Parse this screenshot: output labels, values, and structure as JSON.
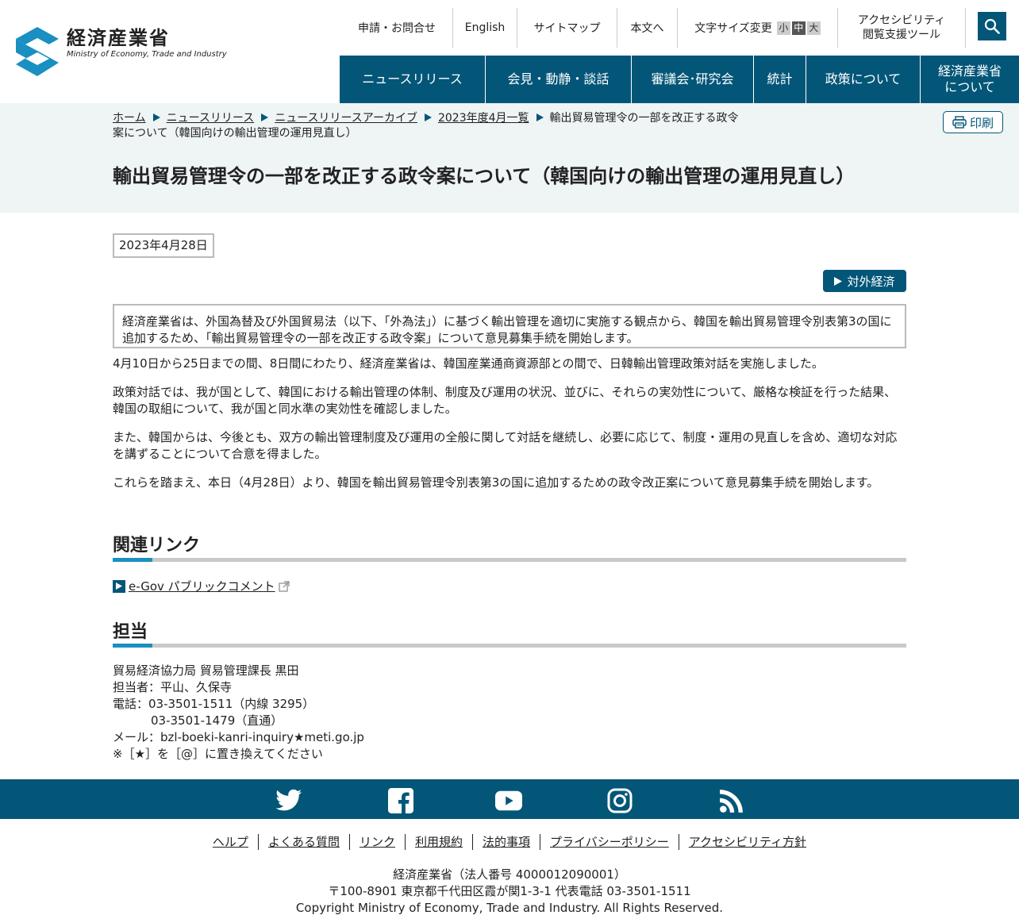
{
  "brand": {
    "name_jp": "経済産業省",
    "name_en": "Ministry of Economy, Trade and Industry"
  },
  "utility_nav": {
    "contact": "申請・お問合せ",
    "english": "English",
    "sitemap": "サイトマップ",
    "skip_to_content": "本文へ",
    "font_size_label": "文字サイズ変更",
    "font_small": "小",
    "font_medium": "中",
    "font_large": "大",
    "accessibility_line1": "アクセシビリティ",
    "accessibility_line2": "閲覧支援ツール"
  },
  "global_nav": [
    {
      "label": "ニュースリリース"
    },
    {
      "label": "会見・動静・談話"
    },
    {
      "label": "審議会･研究会"
    },
    {
      "label": "統計"
    },
    {
      "label": "政策について"
    },
    {
      "label_line1": "経済産業省",
      "label_line2": "について"
    }
  ],
  "breadcrumb": [
    "ホーム",
    "ニュースリリース",
    "ニュースリリースアーカイブ",
    "2023年度4月一覧",
    "輸出貿易管理令の一部を改正する政令案について（韓国向けの輸出管理の運用見直し）"
  ],
  "print_label": "印刷",
  "page_title": "輸出貿易管理令の一部を改正する政令案について（韓国向けの輸出管理の運用見直し）",
  "date": "2023年4月28日",
  "category_tag": "対外経済",
  "summary": "経済産業省は、外国為替及び外国貿易法（以下、「外為法」）に基づく輸出管理を適切に実施する観点から、韓国を輸出貿易管理令別表第3の国に追加するため、「輸出貿易管理令の一部を改正する政令案」について意見募集手続を開始します。",
  "paragraphs": [
    "4月10日から25日までの間、8日間にわたり、経済産業省は、韓国産業通商資源部との間で、日韓輸出管理政策対話を実施しました。",
    "政策対話では、我が国として、韓国における輸出管理の体制、制度及び運用の状況、並びに、それらの実効性について、厳格な検証を行った結果、韓国の取組について、我が国と同水準の実効性を確認しました。",
    "また、韓国からは、今後とも、双方の輸出管理制度及び運用の全般に関して対話を継続し、必要に応じて、制度・運用の見直しを含め、適切な対応を講ずることについて合意を得ました。",
    "これらを踏まえ、本日（4月28日）より、韓国を輸出貿易管理令別表第3の国に追加するための政令改正案について意見募集手続を開始します。"
  ],
  "related": {
    "heading": "関連リンク",
    "link_label": "e-Gov パブリックコメント"
  },
  "contact": {
    "heading": "担当",
    "line1": "貿易経済協力局 貿易管理課長 黒田",
    "line2": "担当者：平山、久保寺",
    "line3": "電話：03-3501-1511（内線 3295）",
    "line4": "03-3501-1479（直通）",
    "line5": "メール：bzl-boeki-kanri-inquiry★meti.go.jp",
    "line6": "※［★］を［@］に置き換えてください"
  },
  "sns": [
    "twitter-icon",
    "facebook-icon",
    "youtube-icon",
    "instagram-icon",
    "rss-icon"
  ],
  "footer_links": [
    "ヘルプ",
    "よくある質問",
    "リンク",
    "利用規約",
    "法的事項",
    "プライバシーポリシー",
    "アクセシビリティ方針"
  ],
  "footer_info": {
    "line1": "経済産業省（法人番号 4000012090001）",
    "line2": "〒100-8901 東京都千代田区霞が関1-3-1 代表電話 03-3501-1511",
    "line3": "Copyright Ministry of Economy, Trade and Industry. All Rights Reserved."
  },
  "colors": {
    "brand": "#035678",
    "accent": "#1a8fc2",
    "band_bg": "#eff4f4"
  }
}
